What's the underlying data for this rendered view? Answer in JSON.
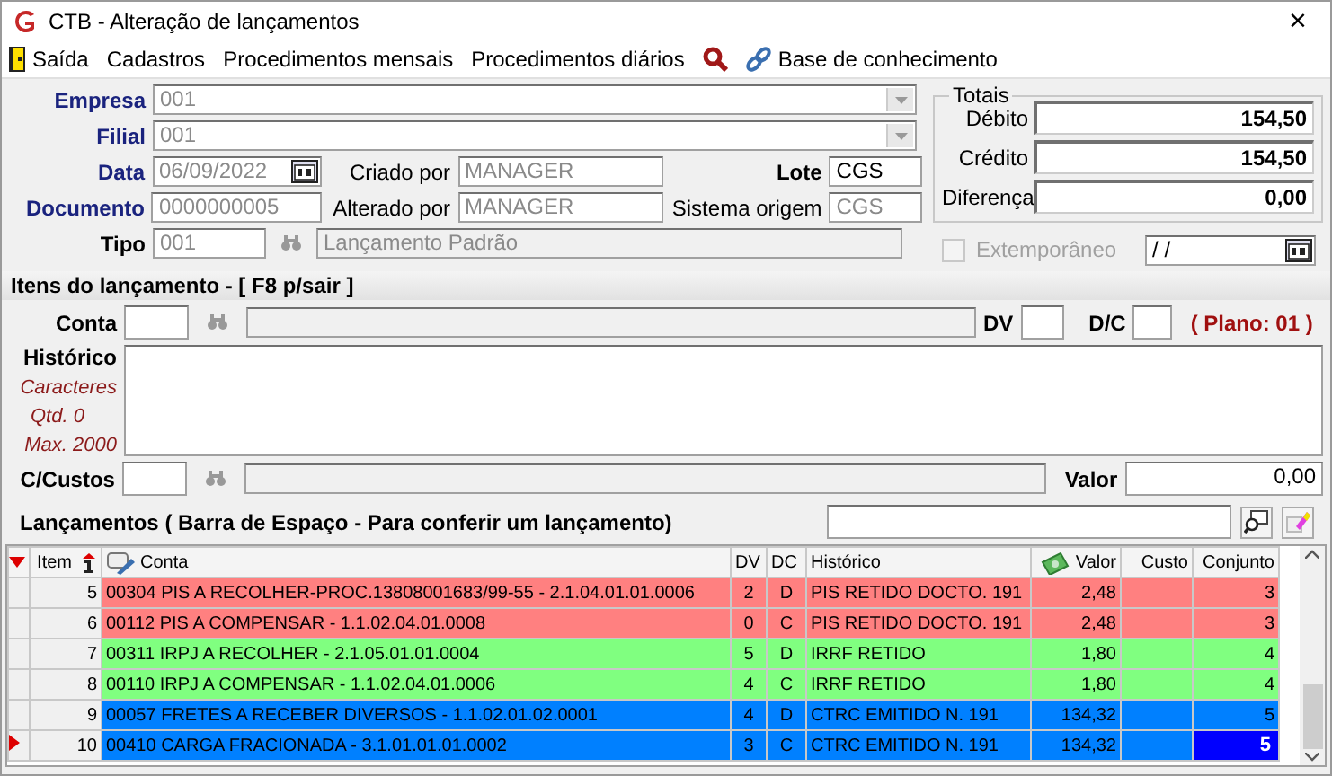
{
  "window": {
    "title": "CTB - Alteração de lançamentos",
    "close": "×"
  },
  "menu": [
    {
      "kind": "door",
      "label": "Saída"
    },
    {
      "kind": "text",
      "label": "Cadastros"
    },
    {
      "kind": "text",
      "label": "Procedimentos mensais"
    },
    {
      "kind": "text",
      "label": "Procedimentos diários"
    },
    {
      "kind": "search"
    },
    {
      "kind": "link",
      "label": "Base de conhecimento"
    }
  ],
  "header": {
    "empresa": {
      "label": "Empresa",
      "value": "001",
      "required": true,
      "disabled": true
    },
    "filial": {
      "label": "Filial",
      "value": "001",
      "required": true,
      "disabled": true
    },
    "data": {
      "label": "Data",
      "value": "06/09/2022",
      "required": true,
      "disabled": true
    },
    "documento": {
      "label": "Documento",
      "value": "0000000005",
      "required": true,
      "disabled": true
    },
    "tipo": {
      "label": "Tipo",
      "value": "001",
      "description": "Lançamento Padrão",
      "required": false,
      "disabled": true
    },
    "criado_por": {
      "label": "Criado por",
      "value": "MANAGER",
      "disabled": true
    },
    "alterado_por": {
      "label": "Alterado por",
      "value": "MANAGER",
      "disabled": true
    },
    "lote": {
      "label": "Lote",
      "value": "CGS",
      "disabled": false
    },
    "sistema_origem": {
      "label": "Sistema origem",
      "value": "CGS",
      "disabled": true
    }
  },
  "totais": {
    "title": "Totais",
    "rows": [
      {
        "label": "Débito",
        "value": "154,50"
      },
      {
        "label": "Crédito",
        "value": "154,50"
      },
      {
        "label": "Diferença",
        "value": "0,00"
      }
    ]
  },
  "extemporaneo": {
    "label": "Extemporâneo",
    "checked": false,
    "disabled": true,
    "date": " / /"
  },
  "itens": {
    "title": "Itens do lançamento - [ F8 p/sair ]",
    "conta_label": "Conta",
    "dv_label": "DV",
    "dc_label": "D/C",
    "plano": "( Plano: 01 )",
    "historico_label": "Histórico",
    "caracteres_label": "Caracteres",
    "qtd": "Qtd. 0",
    "max": "Max. 2000",
    "custos_label": "C/Custos",
    "valor_label": "Valor",
    "valor": "0,00"
  },
  "lancamentos": {
    "title": "Lançamentos ( Barra de Espaço - Para conferir um lançamento)",
    "columns": [
      {
        "label": "Item",
        "sorted": true
      },
      {
        "label": "Conta",
        "sorted": false
      },
      {
        "label": "DV",
        "sorted": false
      },
      {
        "label": "DC",
        "sorted": false
      },
      {
        "label": "Histórico",
        "sorted": false
      },
      {
        "label": "Valor",
        "sorted": false
      },
      {
        "label": "Custo",
        "sorted": false
      },
      {
        "label": "Conjunto",
        "sorted": false
      }
    ],
    "rows": [
      {
        "color": "#ff8080",
        "selected": false,
        "cells": [
          "5",
          "00304 PIS A RECOLHER-PROC.13808001683/99-55 - 2.1.04.01.01.0006",
          "2",
          "D",
          "PIS RETIDO DOCTO. 191",
          "2,48",
          "",
          "3"
        ]
      },
      {
        "color": "#ff8080",
        "selected": false,
        "cells": [
          "6",
          "00112 PIS A COMPENSAR - 1.1.02.04.01.0008",
          "0",
          "C",
          "PIS RETIDO DOCTO. 191",
          "2,48",
          "",
          "3"
        ]
      },
      {
        "color": "#80ff80",
        "selected": false,
        "cells": [
          "7",
          "00311 IRPJ A RECOLHER - 2.1.05.01.01.0004",
          "5",
          "D",
          "IRRF RETIDO",
          "1,80",
          "",
          "4"
        ]
      },
      {
        "color": "#80ff80",
        "selected": false,
        "cells": [
          "8",
          "00110 IRPJ A COMPENSAR - 1.1.02.04.01.0006",
          "4",
          "C",
          "IRRF RETIDO",
          "1,80",
          "",
          "4"
        ]
      },
      {
        "color": "#0080ff",
        "selected": false,
        "cells": [
          "9",
          "00057 FRETES A RECEBER DIVERSOS - 1.1.02.01.02.0001",
          "4",
          "D",
          "CTRC EMITIDO N. 191",
          "134,32",
          "",
          "5"
        ]
      },
      {
        "color": "#0080ff",
        "selected": true,
        "cells": [
          "10",
          "00410 CARGA FRACIONADA - 3.1.01.01.01.0002",
          "3",
          "C",
          "CTRC EMITIDO N. 191",
          "134,32",
          "",
          "5"
        ]
      }
    ]
  }
}
